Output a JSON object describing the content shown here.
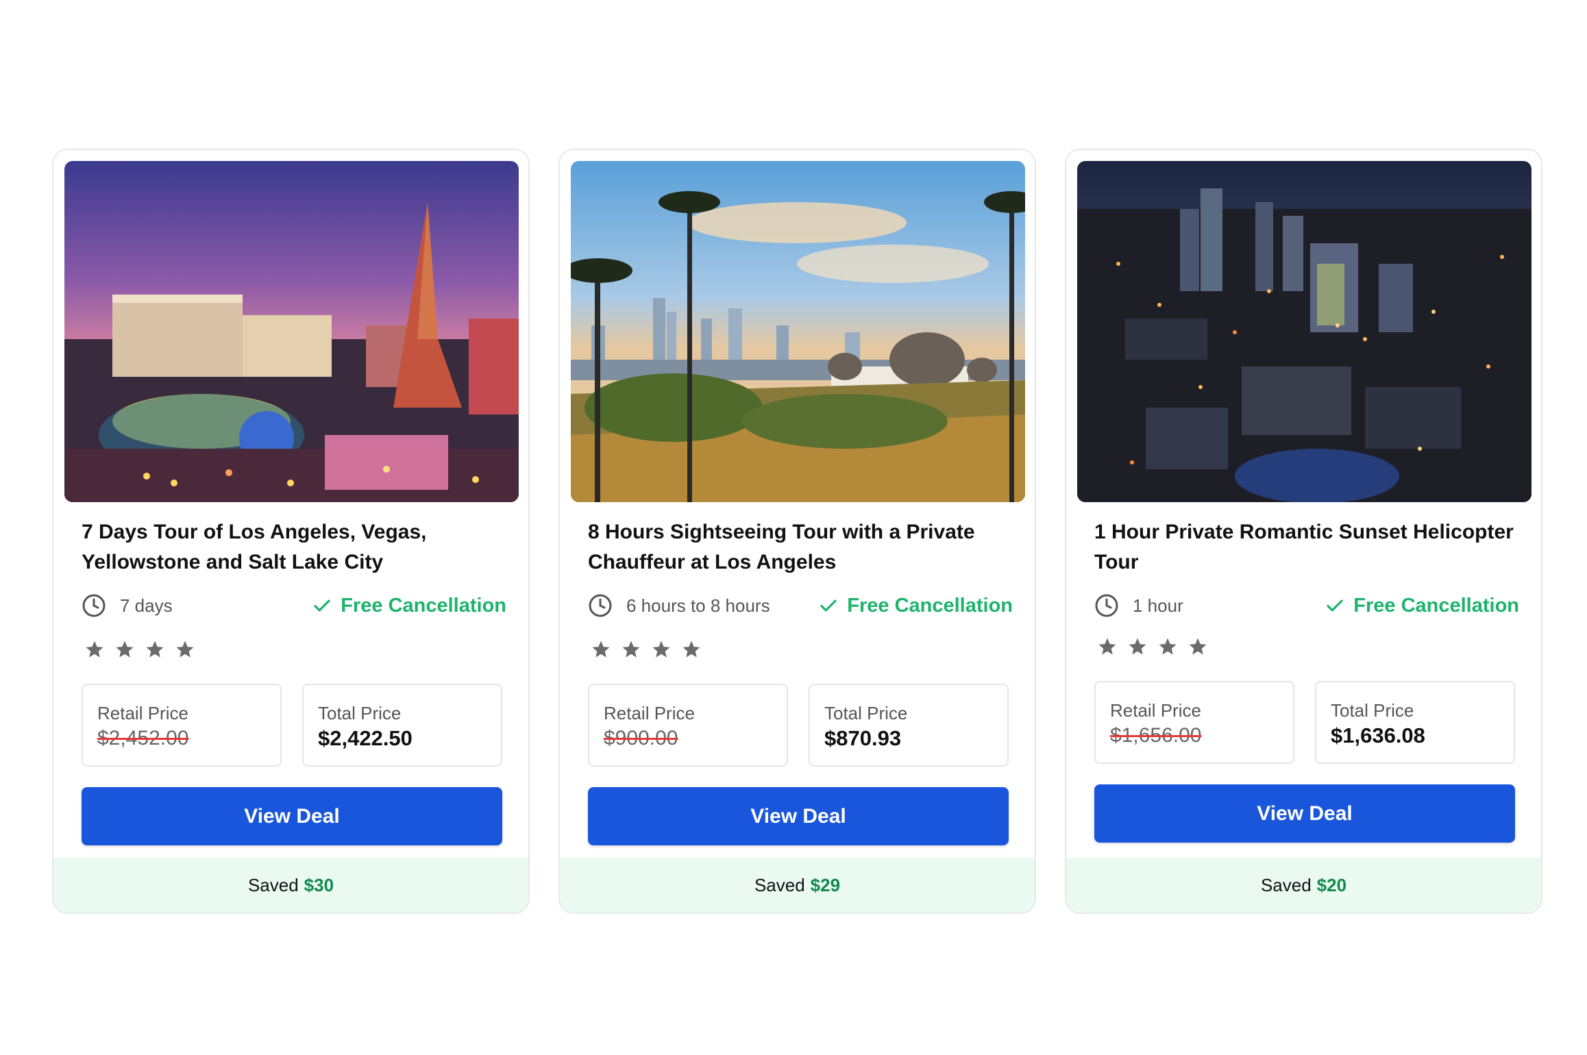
{
  "cards": [
    {
      "image": "las-vegas-strip-night",
      "title": "7 Days Tour of Los Angeles, Vegas, Yellowstone and Salt Lake City",
      "duration": "7 days",
      "cancellation": "Free Cancellation",
      "rating_stars": 4,
      "retail_label": "Retail Price",
      "retail_price": "$2,452.00",
      "total_label": "Total Price",
      "total_price": "$2,422.50",
      "button": "View Deal",
      "saved_label": "Saved",
      "saved_amount": "$30"
    },
    {
      "image": "griffith-observatory-palms",
      "title": "8 Hours Sightseeing Tour with a Private Chauffeur at Los Angeles",
      "duration": "6 hours to 8 hours",
      "cancellation": "Free Cancellation",
      "rating_stars": 4,
      "retail_label": "Retail Price",
      "retail_price": "$900.00",
      "total_label": "Total Price",
      "total_price": "$870.93",
      "button": "View Deal",
      "saved_label": "Saved",
      "saved_amount": "$29"
    },
    {
      "image": "los-angeles-aerial-night",
      "title": "1 Hour Private Romantic Sunset Helicopter Tour",
      "duration": "1 hour",
      "cancellation": "Free Cancellation",
      "rating_stars": 4,
      "retail_label": "Retail Price",
      "retail_price": "$1,656.00",
      "total_label": "Total Price",
      "total_price": "$1,636.08",
      "button": "View Deal",
      "saved_label": "Saved",
      "saved_amount": "$20"
    }
  ],
  "colors": {
    "button": "#1a56db",
    "cancel_green": "#1db36b",
    "saved_green": "#11894e",
    "saved_bg": "#eafaf1",
    "strike_red": "#e53935",
    "star_gray": "#6b6b6b"
  }
}
